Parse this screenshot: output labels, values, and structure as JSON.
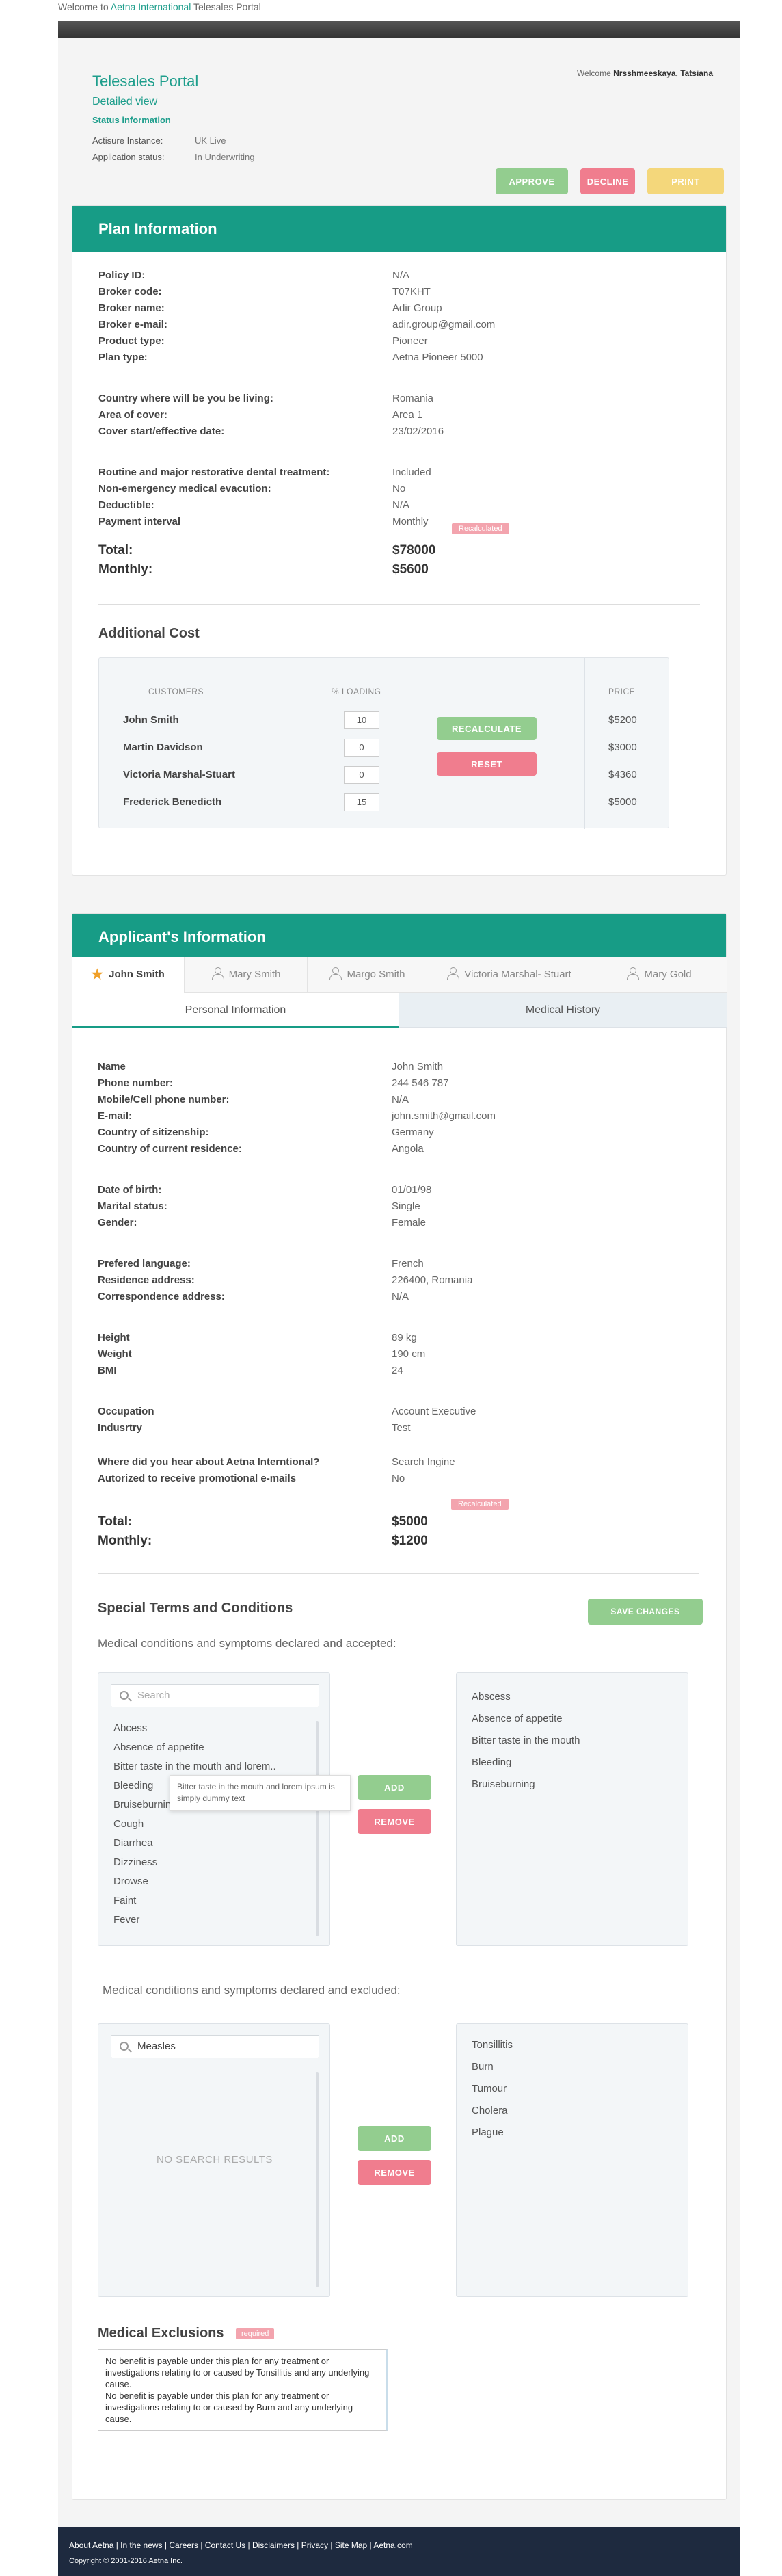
{
  "welcome": {
    "prefix": "Welcome to ",
    "brand": "Aetna International",
    "suffix": " Telesales Portal"
  },
  "header": {
    "title": "Telesales Portal",
    "subtitle": "Detailed view",
    "status_heading": "Status information",
    "instance_label": "Actisure Instance:",
    "instance_value": "UK Live",
    "status_label": "Application status:",
    "status_value": "In Underwriting",
    "welcome_prefix": "Welcome ",
    "user_name": "Nrsshmeeskaya, Tatsiana",
    "approve_label": "APPROVE",
    "decline_label": "DECLINE",
    "print_label": "PRINT"
  },
  "plan": {
    "heading": "Plan Information",
    "rows": [
      {
        "label": "Policy ID:",
        "value": "N/A"
      },
      {
        "label": "Broker code:",
        "value": "T07KHT"
      },
      {
        "label": "Broker name:",
        "value": "Adir Group"
      },
      {
        "label": "Broker e-mail:",
        "value": "adir.group@gmail.com"
      },
      {
        "label": "Product type:",
        "value": "Pioneer"
      },
      {
        "label": "Plan type:",
        "value": "Aetna Pioneer 5000"
      },
      {
        "label": "Country where will be you be living:",
        "value": "Romania"
      },
      {
        "label": "Area of cover:",
        "value": "Area 1"
      },
      {
        "label": "Cover start/effective date:",
        "value": "23/02/2016"
      },
      {
        "label": "Routine and major restorative dental treatment:",
        "value": "Included"
      },
      {
        "label": "Non-emergency medical evacution:",
        "value": "No"
      },
      {
        "label": "Deductible:",
        "value": "N/A"
      },
      {
        "label": "Payment interval",
        "value": "Monthly"
      }
    ],
    "recalculated_tag": "Recalculated",
    "total_label": "Total:",
    "total_value": "$78000",
    "monthly_label": "Monthly:",
    "monthly_value": "$5600"
  },
  "additional_cost": {
    "heading": "Additional Cost",
    "col_customers": "CUSTOMERS",
    "col_loading": "% LOADING",
    "col_price": "PRICE",
    "rows": [
      {
        "name": "John Smith",
        "loading": "10",
        "price": "$5200"
      },
      {
        "name": "Martin Davidson",
        "loading": "0",
        "price": "$3000"
      },
      {
        "name": "Victoria Marshal-Stuart",
        "loading": "0",
        "price": "$4360"
      },
      {
        "name": "Frederick Benedicth",
        "loading": "15",
        "price": "$5000"
      }
    ],
    "recalculate_label": "RECALCULATE",
    "reset_label": "RESET"
  },
  "applicant": {
    "heading": "Applicant's Information",
    "tabs": [
      "John Smith",
      "Mary Smith",
      "Margo Smith",
      "Victoria Marshal- Stuart",
      "Mary Gold"
    ],
    "subtab_personal": "Personal Information",
    "subtab_medical": "Medical History",
    "rows": [
      {
        "label": "Name",
        "value": "John Smith"
      },
      {
        "label": "Phone number:",
        "value": "244 546 787"
      },
      {
        "label": "Mobile/Cell phone number:",
        "value": "N/A"
      },
      {
        "label": "E-mail:",
        "value": "john.smith@gmail.com"
      },
      {
        "label": "Country of sitizenship:",
        "value": "Germany"
      },
      {
        "label": "Country of current residence:",
        "value": "Angola"
      },
      {
        "label": "Date of birth:",
        "value": "01/01/98"
      },
      {
        "label": "Marital status:",
        "value": "Single"
      },
      {
        "label": "Gender:",
        "value": "Female"
      },
      {
        "label": "Prefered language:",
        "value": "French"
      },
      {
        "label": "Residence address:",
        "value": "226400, Romania"
      },
      {
        "label": "Correspondence address:",
        "value": "N/A"
      },
      {
        "label": "Height",
        "value": "89 kg"
      },
      {
        "label": "Weight",
        "value": "190 cm"
      },
      {
        "label": "BMI",
        "value": "24"
      },
      {
        "label": "Occupation",
        "value": "Account Executive"
      },
      {
        "label": "Indusrtry",
        "value": "Test"
      },
      {
        "label": "Where did you hear about Aetna Interntional?",
        "value": "Search Ingine"
      },
      {
        "label": "Autorized to receive promotional e-mails",
        "value": "No"
      }
    ],
    "recalculated_tag": "Recalculated",
    "total_label": "Total:",
    "total_value": "$5000",
    "monthly_label": "Monthly:",
    "monthly_value": "$1200"
  },
  "terms": {
    "heading": "Special Terms and Conditions",
    "save_label": "SAVE CHANGES",
    "accepted_label": "Medical conditions and symptoms declared and accepted:",
    "search_placeholder": "Search",
    "accepted_list": [
      "Abcess",
      "Absence of appetite",
      "Bitter taste in the mouth and lorem..",
      "Bleeding",
      "Bruiseburning",
      "Cough",
      "Diarrhea",
      "Dizziness",
      "Drowse",
      "Faint",
      "Fever"
    ],
    "tooltip": "Bitter taste in the mouth and lorem ipsum is simply dummy text",
    "accepted_selected": [
      "Abscess",
      "Absence of appetite",
      "Bitter taste in the mouth",
      "Bleeding",
      "Bruiseburning"
    ],
    "add_label": "ADD",
    "remove_label": "REMOVE",
    "excluded_label": "Medical conditions and symptoms declared and excluded:",
    "excluded_search_value": "Measles",
    "no_results": "NO SEARCH RESULTS",
    "excluded_selected": [
      "Tonsillitis",
      "Burn",
      "Tumour",
      "Cholera",
      "Plague"
    ]
  },
  "exclusions": {
    "heading": "Medical Exclusions",
    "required_tag": "required",
    "text": "No benefit is payable under this plan for any treatment or investigations relating to or caused by Tonsillitis and any underlying cause.\nNo benefit is payable under this plan for any treatment or investigations relating to or caused by Burn and any underlying cause."
  },
  "footer": {
    "links": "About Aetna | In the news | Careers | Contact Us | Disclaimers | Privacy | Site Map | Aetna.com",
    "copyright": "Copyright © 2001-2016 Aetna Inc."
  },
  "colors": {
    "brand_teal": "#179c86",
    "approve": "#93cd8f",
    "decline": "#f07d8e",
    "print": "#f4d77b",
    "footer": "#1e2a3f"
  }
}
